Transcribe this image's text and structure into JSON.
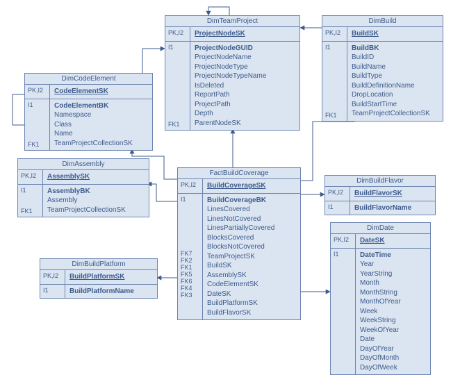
{
  "tables": {
    "dimTeamProject": {
      "title": "DimTeamProject",
      "pkLabel": "PK,I2",
      "pkField": "ProjectNodeSK",
      "bodyKeysTop": "I1",
      "bodyKeysBottom": "FK1",
      "boldField": "ProjectNodeGUID",
      "fields": [
        "ProjectNodeName",
        "ProjectNodeType",
        "ProjectNodeTypeName",
        "IsDeleted",
        "ReportPath",
        "ProjectPath",
        "Depth",
        "ParentNodeSK"
      ]
    },
    "dimBuild": {
      "title": "DimBuild",
      "pkLabel": "PK,I2",
      "pkField": "BuildSK",
      "bodyKeysTop": "I1",
      "bodyKeysBottom": "FK1",
      "boldField": "BuildBK",
      "fields": [
        "BuildID",
        "BuildName",
        "BuildType",
        "BuildDefinitionName",
        "DropLocation",
        "BuildStartTime",
        "TeamProjectCollectionSK"
      ]
    },
    "dimCodeElement": {
      "title": "DimCodeElement",
      "pkLabel": "PK,I2",
      "pkField": "CodeElementSK",
      "bodyKeysTop": "I1",
      "bodyKeysBottom": "FK1",
      "boldField": "CodeElementBK",
      "fields": [
        "Namespace",
        "Class",
        "Name",
        "TeamProjectCollectionSK"
      ]
    },
    "dimAssembly": {
      "title": "DimAssembly",
      "pkLabel": "PK,I2",
      "pkField": "AssemblySK",
      "bodyKeysTop": "I1",
      "bodyKeysBottom": "FK1",
      "boldField": "AssemblyBK",
      "fields": [
        "Assembly",
        "TeamProjectCollectionSK"
      ]
    },
    "dimBuildPlatform": {
      "title": "DimBuildPlatform",
      "pkLabel": "PK,I2",
      "pkField": "BuildPlatformSK",
      "row2Key": "I1",
      "row2Field": "BuildPlatformName"
    },
    "factBuildCoverage": {
      "title": "FactBuildCoverage",
      "pkLabel": "PK,I2",
      "pkField": "BuildCoverageSK",
      "bodyKeysTop": "I1",
      "boldField": "BuildCoverageBK",
      "attrs": [
        "LinesCovered",
        "LinesNotCovered",
        "LinesPartiallyCovered",
        "BlocksCovered",
        "BlocksNotCovered"
      ],
      "fkLabels": [
        "FK7",
        "FK2",
        "FK1",
        "FK5",
        "FK6",
        "FK4",
        "FK3"
      ],
      "fkFields": [
        "TeamProjectSK",
        "BuildSK",
        "AssemblySK",
        "CodeElementSK",
        "DateSK",
        "BuildPlatformSK",
        "BuildFlavorSK"
      ]
    },
    "dimBuildFlavor": {
      "title": "DimBuildFlavor",
      "pkLabel": "PK,I2",
      "pkField": "BuildFlavorSK",
      "row2Key": "I1",
      "row2Field": "BuildFlavorName"
    },
    "dimDate": {
      "title": "DimDate",
      "pkLabel": "PK,I2",
      "pkField": "DateSK",
      "bodyKeysTop": "I1",
      "boldField": "DateTime",
      "fields": [
        "Year",
        "YearString",
        "Month",
        "MonthString",
        "MonthOfYear",
        "Week",
        "WeekString",
        "WeekOfYear",
        "Date",
        "DayOfYear",
        "DayOfMonth",
        "DayOfWeek"
      ]
    }
  }
}
